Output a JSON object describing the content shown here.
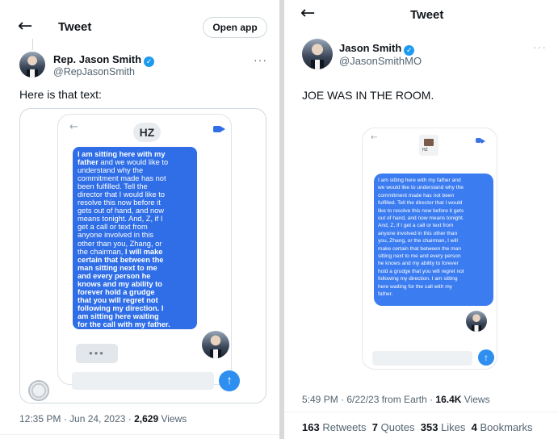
{
  "left": {
    "header": {
      "back": "←",
      "title": "Tweet",
      "open_app": "Open app"
    },
    "author": {
      "name": "Rep. Jason Smith",
      "handle": "@RepJasonSmith",
      "more": "···"
    },
    "text": "Here is that text:",
    "screenshot": {
      "back": "←",
      "contact": "HZ",
      "message_lines": [
        "I am sitting here with my",
        "father and we would like to",
        "understand why the",
        "commitment made has not",
        "been fulfilled.  Tell the",
        "director that I would like to",
        "resolve this now before it",
        "gets out of hand, and now",
        "means tonight.  And, Z, if I",
        "get a call or text from",
        "anyone involved in this",
        "other than you, Zhang, or",
        "the chairman, I will make",
        "certain that between the",
        "man sitting next to me",
        "and every person he",
        "knows and my ability to",
        "forever hold a grudge",
        "that you will regret not",
        "following my direction.  I",
        "am sitting here waiting",
        "for the call with my father."
      ],
      "typing": "•••",
      "send": "↑"
    },
    "meta": {
      "time": "12:35 PM · Jun 24, 2023 · ",
      "views_count": "2,629",
      "views_label": " Views"
    }
  },
  "right": {
    "header": {
      "back": "←",
      "title": "Tweet"
    },
    "author": {
      "name": "Jason Smith",
      "handle": "@JasonSmithMO",
      "more": "···"
    },
    "text": "JOE WAS IN THE ROOM.",
    "screenshot": {
      "back": "←",
      "contact": "HZ",
      "message": "I am sitting here with my father and\nwe would like to understand why the\ncommitment made has not been\nfulfilled. Tell the director that I would\nlike to resolve this now before it gets\nout of hand, and now means tonight.\nAnd, Z, if I get a call or text from\nanyone involved in this other than\nyou, Zhang, or the chairman, I will\nmake certain that between the man\nsitting next to me and every person\nhe knows and my ability to forever\nhold a grudge that you will regret not\nfollowing my direction. I am sitting\nhere waiting for the call with my\nfather.",
      "send": "↑"
    },
    "meta": {
      "time": "5:49 PM · 6/22/23 from Earth · ",
      "views_count": "16.4K",
      "views_label": " Views"
    },
    "stats": {
      "retweets_count": "163",
      "retweets_label": " Retweets",
      "quotes_count": "7",
      "quotes_label": " Quotes",
      "likes_count": "353",
      "likes_label": " Likes",
      "bookmarks_count": "4",
      "bookmarks_label": " Bookmarks"
    }
  },
  "colors": {
    "accent": "#1d9bf0",
    "bubble": "#2f6ee6",
    "muted": "#536471"
  }
}
